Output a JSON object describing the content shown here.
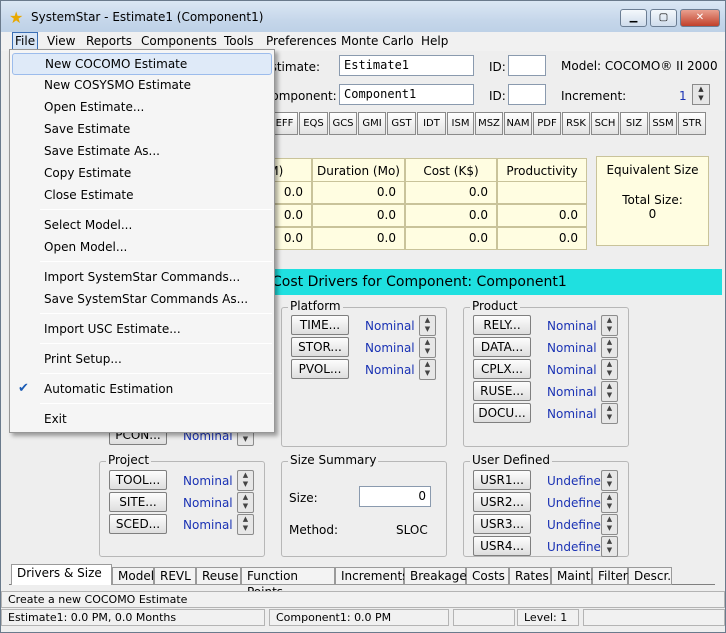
{
  "title": "SystemStar - Estimate1 (Component1)",
  "menubar": [
    "File",
    "View",
    "Reports",
    "Components",
    "Tools",
    "Preferences",
    "Monte Carlo",
    "Help"
  ],
  "header": {
    "estimate_label": "Estimate:",
    "estimate_value": "Estimate1",
    "id_label": "ID:",
    "model_label": "Model: COCOMO® II 2000",
    "component_label": "Component:",
    "component_value": "Component1",
    "id_label2": "ID:",
    "increment_label": "Increment:",
    "increment_value": "1"
  },
  "toolbar": [
    "EFF",
    "EQS",
    "GCS",
    "GMI",
    "GST",
    "IDT",
    "ISM",
    "MSZ",
    "NAM",
    "PDF",
    "RSK",
    "SCH",
    "SIZ",
    "SSM",
    "STR"
  ],
  "results": {
    "headers": [
      "Effort (PM)",
      "Duration (Mo)",
      "Cost (K$)",
      "Productivity"
    ],
    "rows": [
      [
        "0.0",
        "0.0",
        "0.0",
        ""
      ],
      [
        "0.0",
        "0.0",
        "0.0",
        "0.0"
      ],
      [
        "0.0",
        "0.0",
        "0.0",
        "0.0"
      ]
    ],
    "equiv_title": "Equivalent Size",
    "total_size_label": "Total Size:",
    "total_size_value": "0"
  },
  "banner": "Cost Drivers for Component: Component1",
  "platform": {
    "title": "Platform",
    "drivers": [
      {
        "btn": "TIME...",
        "val": "Nominal"
      },
      {
        "btn": "STOR...",
        "val": "Nominal"
      },
      {
        "btn": "PVOL...",
        "val": "Nominal"
      }
    ]
  },
  "product": {
    "title": "Product",
    "drivers": [
      {
        "btn": "RELY...",
        "val": "Nominal"
      },
      {
        "btn": "DATA...",
        "val": "Nominal"
      },
      {
        "btn": "CPLX...",
        "val": "Nominal"
      },
      {
        "btn": "RUSE...",
        "val": "Nominal"
      },
      {
        "btn": "DOCU...",
        "val": "Nominal"
      }
    ]
  },
  "personnel": {
    "btn": "PCON...",
    "val": "Nominal"
  },
  "project": {
    "title": "Project",
    "drivers": [
      {
        "btn": "TOOL...",
        "val": "Nominal"
      },
      {
        "btn": "SITE...",
        "val": "Nominal"
      },
      {
        "btn": "SCED...",
        "val": "Nominal"
      }
    ]
  },
  "size_summary": {
    "title": "Size Summary",
    "size_label": "Size:",
    "size_value": "0",
    "method_label": "Method:",
    "method_value": "SLOC"
  },
  "user_defined": {
    "title": "User Defined",
    "drivers": [
      {
        "btn": "USR1...",
        "val": "Undefined"
      },
      {
        "btn": "USR2...",
        "val": "Undefined"
      },
      {
        "btn": "USR3...",
        "val": "Undefined"
      },
      {
        "btn": "USR4...",
        "val": "Undefined"
      }
    ]
  },
  "tabs": [
    "Drivers & Size",
    "Model",
    "REVL",
    "Reuse",
    "Function Points",
    "Increments",
    "Breakage",
    "Costs",
    "Rates",
    "Maint.",
    "Filter",
    "Descr."
  ],
  "status_line": "Create a new COCOMO Estimate",
  "status_bar": {
    "estimate": "Estimate1:  0.0 PM,  0.0 Months",
    "component": "Component1:  0.0 PM",
    "level_label": "Level:",
    "level_value": "1"
  },
  "file_menu": [
    "New COCOMO Estimate",
    "New COSYSMO Estimate",
    "Open Estimate...",
    "Save Estimate",
    "Save Estimate As...",
    "Copy Estimate",
    "Close Estimate",
    "Select Model...",
    "Open Model...",
    "Import SystemStar Commands...",
    "Save SystemStar Commands As...",
    "Import USC Estimate...",
    "Print Setup...",
    "Automatic Estimation",
    "Exit"
  ],
  "colors": {
    "banner": "#1fe0e0",
    "value_text": "#1a32b4",
    "cell_bg": "#fffde1"
  }
}
